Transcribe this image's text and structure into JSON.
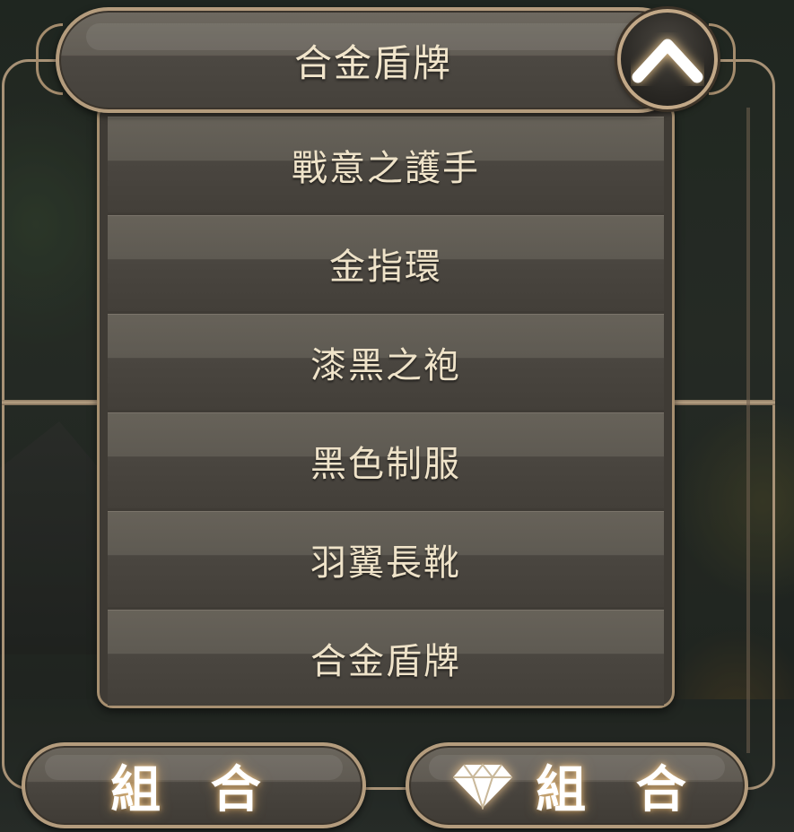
{
  "header": {
    "selected": "合金盾牌",
    "toggle_icon": "chevron-up-icon"
  },
  "dropdown": {
    "items": [
      {
        "label": "戰意之護手"
      },
      {
        "label": "金指環"
      },
      {
        "label": "漆黑之袍"
      },
      {
        "label": "黑色制服"
      },
      {
        "label": "羽翼長靴"
      },
      {
        "label": "合金盾牌"
      }
    ]
  },
  "buttons": {
    "combine": "組 合",
    "combine_gem": "組 合",
    "gem_icon": "diamond-icon"
  },
  "colors": {
    "text": "#efe3c9",
    "frame": "#b49c7d",
    "glow": "#ffd696"
  }
}
